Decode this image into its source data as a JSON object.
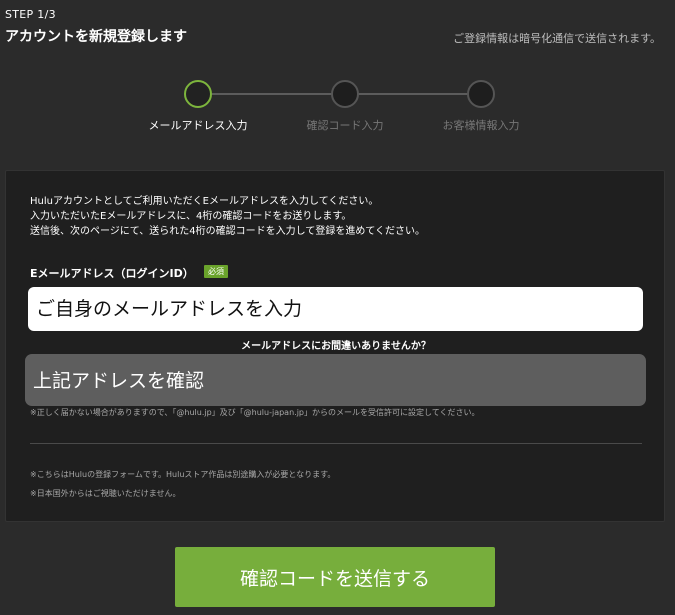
{
  "header": {
    "step_label": "STEP 1/3",
    "title": "アカウントを新規登録します",
    "secure_note": "ご登録情報は暗号化通信で送信されます。"
  },
  "stepper": {
    "steps": [
      {
        "label": "メールアドレス入力",
        "state": "active"
      },
      {
        "label": "確認コード入力",
        "state": "upcoming"
      },
      {
        "label": "お客様情報入力",
        "state": "upcoming"
      }
    ]
  },
  "form": {
    "intro_lines": [
      "Huluアカウントとしてご利用いただくEメールアドレスを入力してください。",
      "入力いただいたEメールアドレスに、4桁の確認コードをお送りします。",
      "送信後、次のページにて、送られた4桁の確認コードを入力して登録を進めてください。"
    ],
    "email_label": "Eメールアドレス（ログインID）",
    "required_badge": "必須",
    "email_placeholder": "ご自身のメールアドレスを入力",
    "email_value": "",
    "mistake_question": "メールアドレスにお間違いありませんか？",
    "confirm_text": "上記アドレスを確認",
    "mail_setting_note": "※正しく届かない場合がありますので、「@hulu.jp」及び「@hulu-japan.jp」からのメールを受信許可に設定してください。",
    "footnotes": [
      "※こちらはHuluの登録フォームです。Huluストア作品は別途購入が必要となります。",
      "※日本国外からはご視聴いただけません。"
    ],
    "submit_label": "確認コードを送信する"
  },
  "colors": {
    "accent": "#77ae3c",
    "background": "#2b2b2b",
    "panel": "#1f1f1f"
  }
}
